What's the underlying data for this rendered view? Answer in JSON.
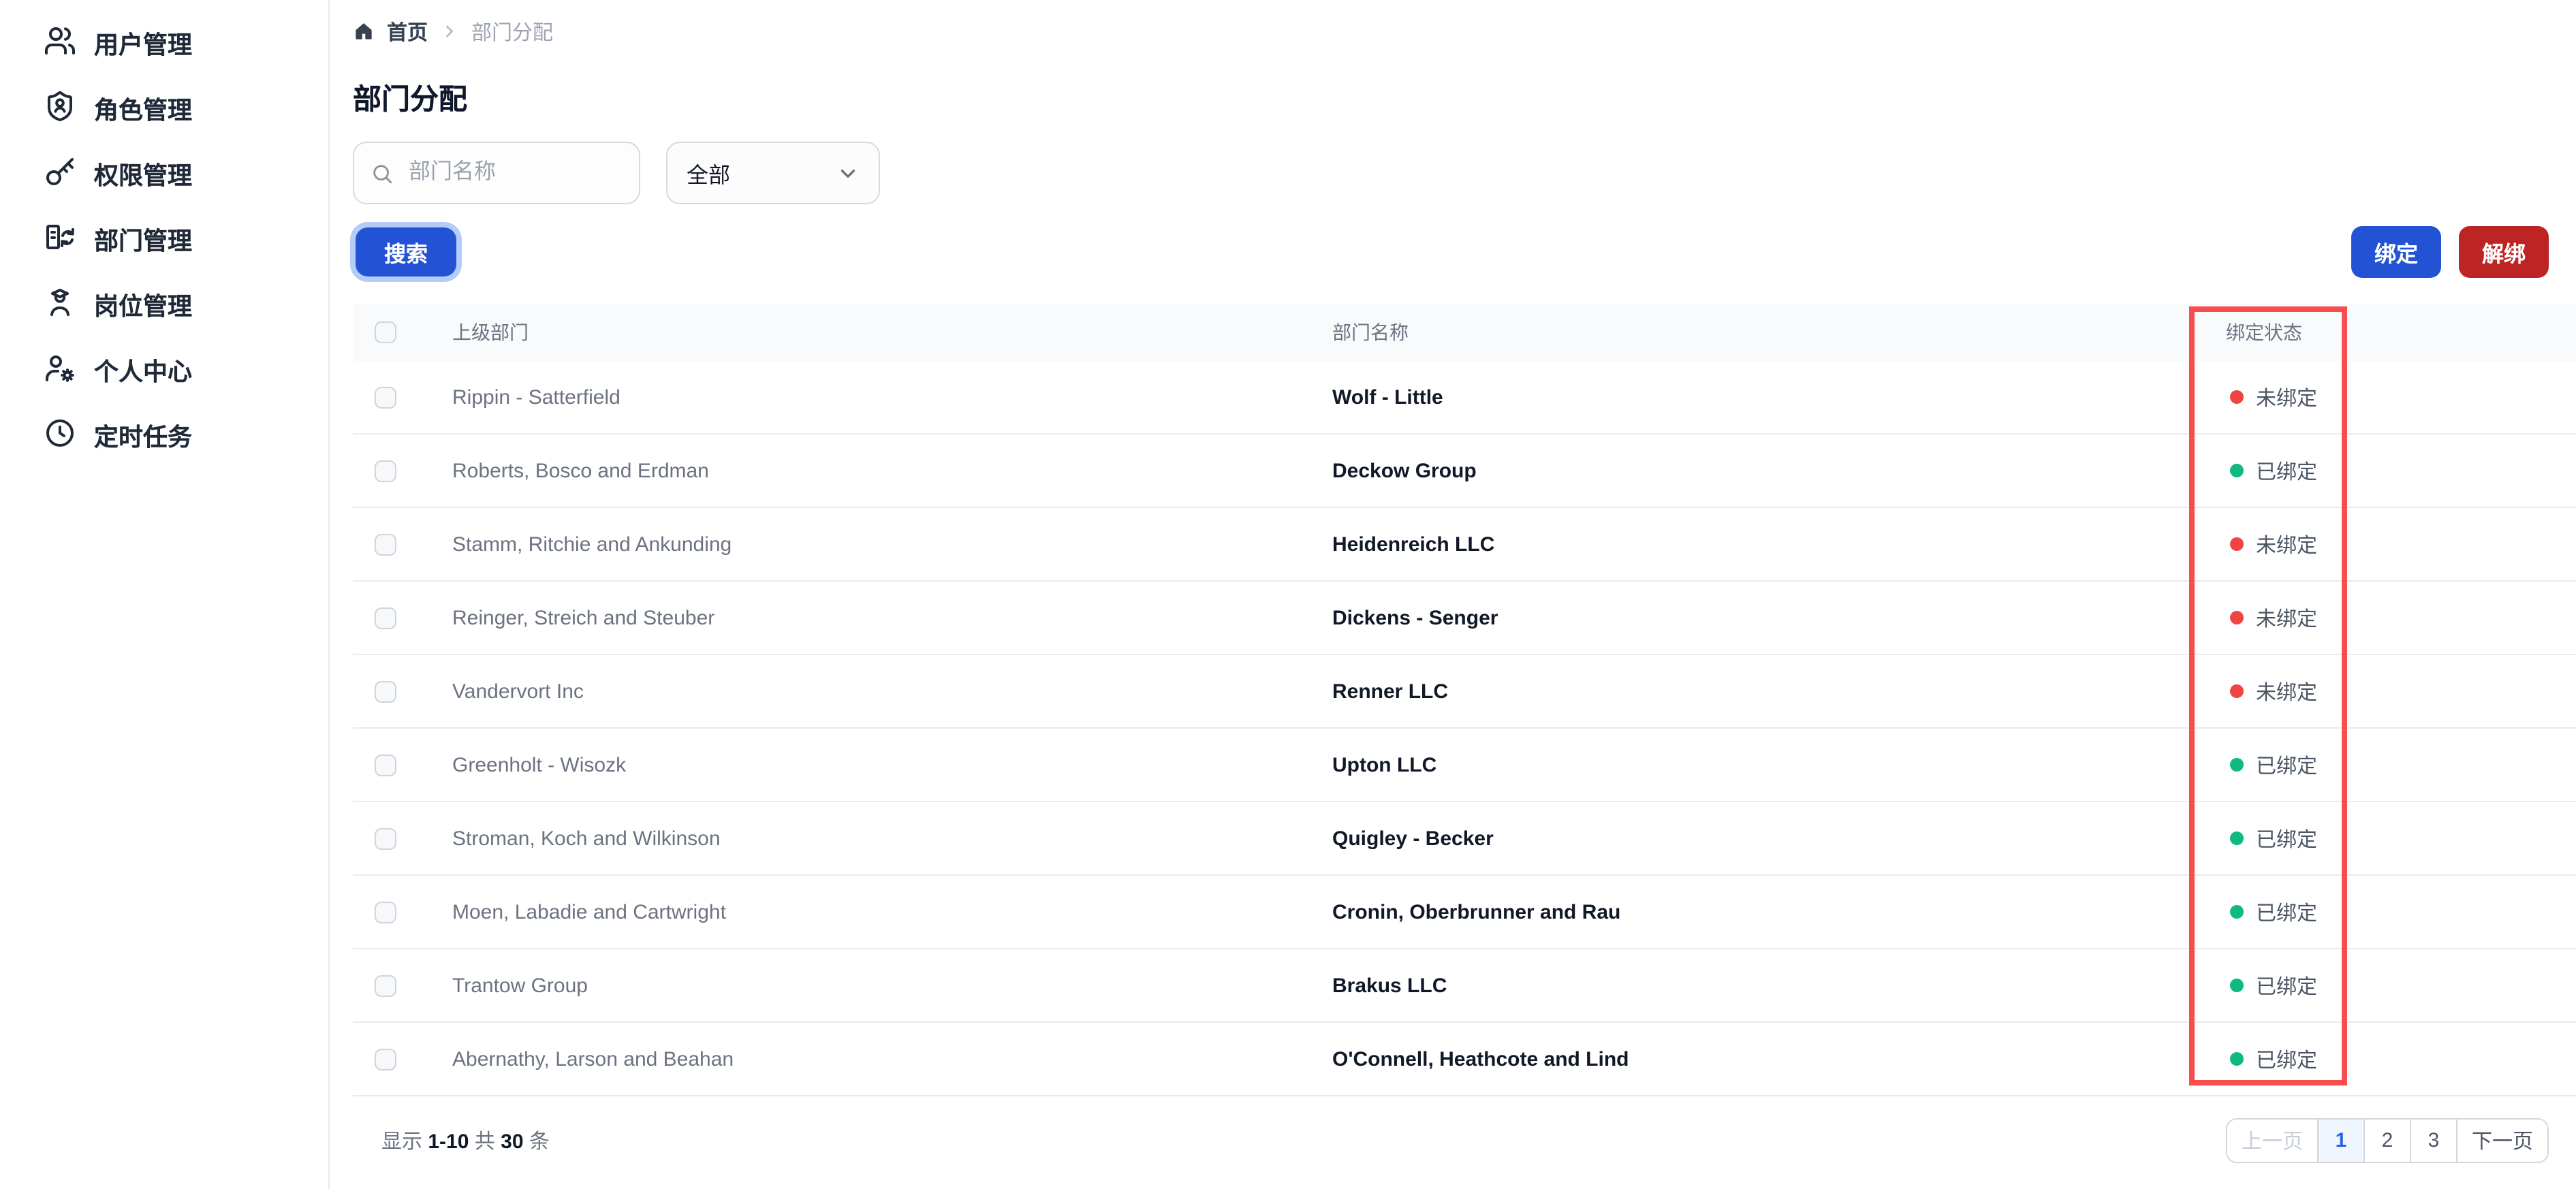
{
  "sidebar": {
    "items": [
      {
        "label": "用户管理",
        "icon": "users-icon"
      },
      {
        "label": "角色管理",
        "icon": "shield-user-icon"
      },
      {
        "label": "权限管理",
        "icon": "key-icon"
      },
      {
        "label": "部门管理",
        "icon": "department-icon"
      },
      {
        "label": "岗位管理",
        "icon": "position-icon"
      },
      {
        "label": "个人中心",
        "icon": "user-settings-icon"
      },
      {
        "label": "定时任务",
        "icon": "clock-icon"
      }
    ]
  },
  "breadcrumb": {
    "home": "首页",
    "current": "部门分配"
  },
  "page": {
    "title": "部门分配"
  },
  "filters": {
    "search_placeholder": "部门名称",
    "filter_value": "全部",
    "search_button": "搜索"
  },
  "actions": {
    "bind": "绑定",
    "unbind": "解绑"
  },
  "table": {
    "headers": {
      "parent": "上级部门",
      "name": "部门名称",
      "status": "绑定状态"
    },
    "status_labels": {
      "bound": "已绑定",
      "unbound": "未绑定"
    },
    "rows": [
      {
        "parent": "Rippin - Satterfield",
        "name": "Wolf - Little",
        "bound": false
      },
      {
        "parent": "Roberts, Bosco and Erdman",
        "name": "Deckow Group",
        "bound": true
      },
      {
        "parent": "Stamm, Ritchie and Ankunding",
        "name": "Heidenreich LLC",
        "bound": false
      },
      {
        "parent": "Reinger, Streich and Steuber",
        "name": "Dickens - Senger",
        "bound": false
      },
      {
        "parent": "Vandervort Inc",
        "name": "Renner LLC",
        "bound": false
      },
      {
        "parent": "Greenholt - Wisozk",
        "name": "Upton LLC",
        "bound": true
      },
      {
        "parent": "Stroman, Koch and Wilkinson",
        "name": "Quigley - Becker",
        "bound": true
      },
      {
        "parent": "Moen, Labadie and Cartwright",
        "name": "Cronin, Oberbrunner and Rau",
        "bound": true
      },
      {
        "parent": "Trantow Group",
        "name": "Brakus LLC",
        "bound": true
      },
      {
        "parent": "Abernathy, Larson and Beahan",
        "name": "O'Connell, Heathcote and Lind",
        "bound": true
      }
    ]
  },
  "pagination": {
    "summary": {
      "prefix": "显示",
      "range": "1-10",
      "middle": "共",
      "total": "30",
      "suffix": "条"
    },
    "prev": "上一页",
    "pages": [
      "1",
      "2",
      "3"
    ],
    "active_page": "1",
    "next": "下一页"
  },
  "colors": {
    "primary": "#2353d4",
    "primary_ring": "#b3cdf8",
    "danger": "#bd2424",
    "status_unbound": "#ef4444",
    "status_bound": "#10b981",
    "highlight_box": "#f94d4d",
    "active_page_bg": "#eff6ff",
    "active_page_text": "#2563eb"
  }
}
